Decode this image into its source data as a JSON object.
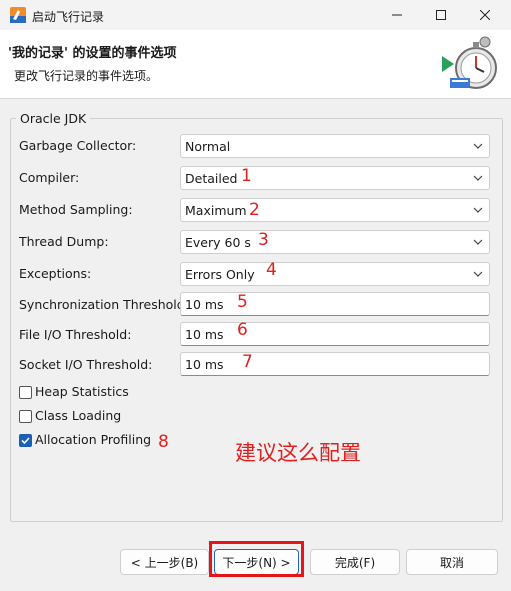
{
  "window": {
    "title": "启动飞行记录"
  },
  "header": {
    "title": "'我的记录' 的设置的事件选项",
    "subtitle": "更改飞行记录的事件选项。"
  },
  "group": {
    "legend": "Oracle JDK"
  },
  "fields": {
    "gc": {
      "label": "Garbage Collector:",
      "value": "Normal"
    },
    "compiler": {
      "label": "Compiler:",
      "value": "Detailed",
      "mark": "1"
    },
    "method_sampling": {
      "label": "Method Sampling:",
      "value": "Maximum",
      "mark": "2"
    },
    "thread_dump": {
      "label": "Thread Dump:",
      "value": "Every 60 s",
      "mark": "3"
    },
    "exceptions": {
      "label": "Exceptions:",
      "value": "Errors Only",
      "mark": "4"
    },
    "sync_threshold": {
      "label": "Synchronization Threshold:",
      "value": "10 ms",
      "mark": "5"
    },
    "file_io_threshold": {
      "label": "File I/O Threshold:",
      "value": "10 ms",
      "mark": "6"
    },
    "socket_io_threshold": {
      "label": "Socket I/O Threshold:",
      "value": "10 ms",
      "mark": "7"
    }
  },
  "checkboxes": {
    "heap_statistics": {
      "label": "Heap Statistics",
      "checked": false
    },
    "class_loading": {
      "label": "Class Loading",
      "checked": false
    },
    "allocation_profiling": {
      "label": "Allocation Profiling",
      "checked": true,
      "mark": "8"
    }
  },
  "advice": "建议这么配置",
  "buttons": {
    "back": "< 上一步(B)",
    "next": "下一步(N) >",
    "finish": "完成(F)",
    "cancel": "取消"
  },
  "colors": {
    "annotation": "#e0201f",
    "accent": "#1a5fb4"
  }
}
